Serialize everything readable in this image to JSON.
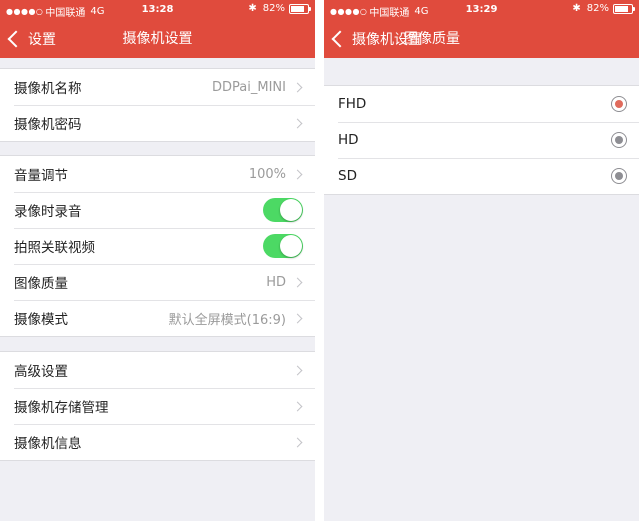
{
  "colors": {
    "accent": "#e04b3d",
    "toggle_on": "#4cd964",
    "radio_selected": "#e06b5c",
    "radio_unselected": "#8e8e93"
  },
  "left_screen": {
    "status": {
      "signal_dots": "●●●●○",
      "carrier": "中国联通",
      "network": "4G",
      "time": "13:28",
      "bluetooth_icon": "✱",
      "battery_percent_text": "82%",
      "battery_level": 0.82
    },
    "nav": {
      "back_label": "设置",
      "title": "摄像机设置"
    },
    "group1": [
      {
        "label": "摄像机名称",
        "value": "DDPai_MINI"
      },
      {
        "label": "摄像机密码",
        "value": ""
      }
    ],
    "group2": {
      "volume": {
        "label": "音量调节",
        "value": "100%"
      },
      "record_audio": {
        "label": "录像时录音",
        "on": true
      },
      "photo_link_video": {
        "label": "拍照关联视频",
        "on": true
      },
      "image_quality": {
        "label": "图像质量",
        "value": "HD"
      },
      "camera_mode": {
        "label": "摄像模式",
        "value": "默认全屏模式(16:9)"
      }
    },
    "group3": [
      {
        "label": "高级设置"
      },
      {
        "label": "摄像机存储管理"
      },
      {
        "label": "摄像机信息"
      }
    ]
  },
  "right_screen": {
    "status": {
      "signal_dots": "●●●●○",
      "carrier": "中国联通",
      "network": "4G",
      "time": "13:29",
      "bluetooth_icon": "✱",
      "battery_percent_text": "82%",
      "battery_level": 0.82
    },
    "nav": {
      "back_label": "摄像机设置",
      "title": "图像质量"
    },
    "options": [
      {
        "label": "FHD",
        "selected": true
      },
      {
        "label": "HD",
        "selected": false
      },
      {
        "label": "SD",
        "selected": false
      }
    ]
  }
}
